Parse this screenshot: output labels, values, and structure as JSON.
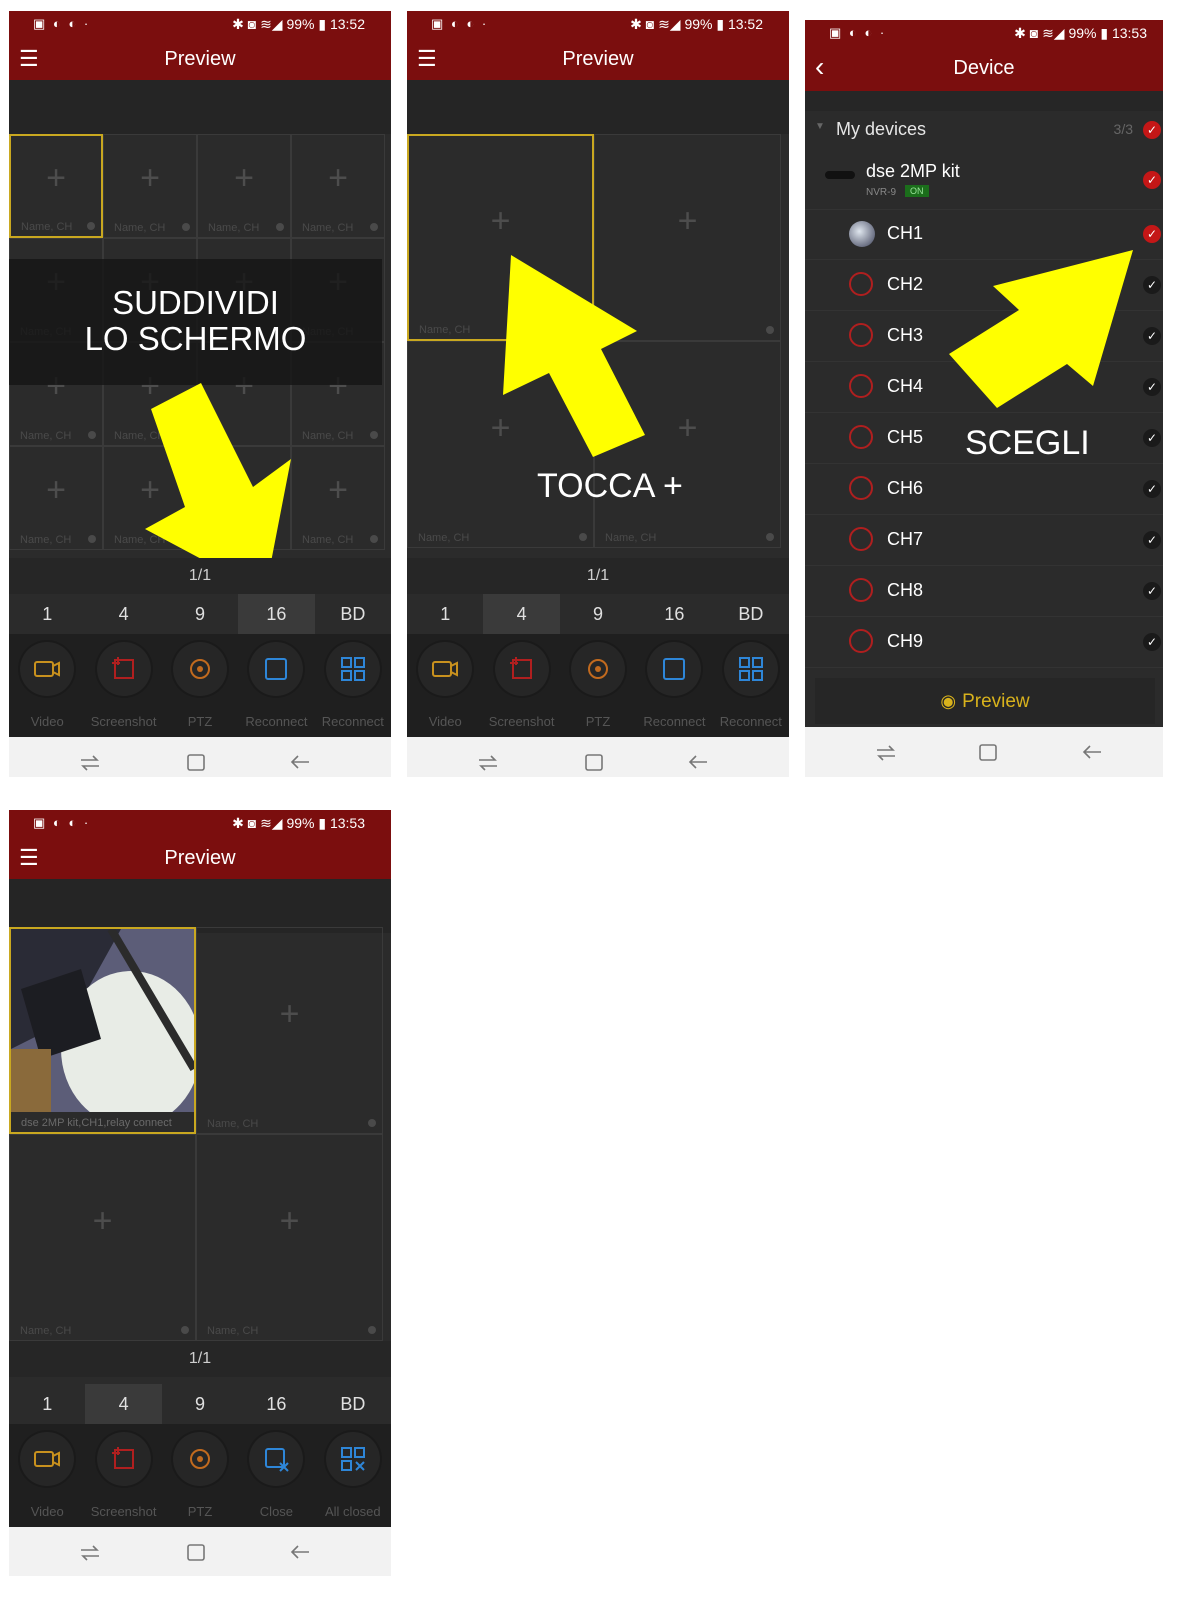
{
  "status": {
    "left_icons": "▣ ◐ ◐ ·",
    "right_1": "✱ ◙ ≋◢ 99% ▮ 13:52",
    "right_3": "✱ ◙ ≋◢ 99% ▮ 13:53"
  },
  "screen_titles": {
    "preview": "Preview",
    "device": "Device"
  },
  "cell_label": "Name, CH",
  "live_cell_label": "dse 2MP kit,CH1,relay connect",
  "page_indicator": "1/1",
  "split_tabs": [
    "1",
    "4",
    "9",
    "16",
    "BD"
  ],
  "actions_a": [
    "Video",
    "Screenshot",
    "PTZ",
    "Reconnect",
    "Reconnect"
  ],
  "actions_b": [
    "Video",
    "Screenshot",
    "PTZ",
    "Close",
    "All closed"
  ],
  "annotations": {
    "split_line1": "SUDDIVIDI",
    "split_line2": "LO SCHERMO",
    "tap": "TOCCA +",
    "choose": "SCEGLI"
  },
  "device_list": {
    "group": "My devices",
    "count": "3/3",
    "device_name": "dse 2MP kit",
    "device_model": "NVR-9",
    "device_status": "ON",
    "channels": [
      "CH1",
      "CH2",
      "CH3",
      "CH4",
      "CH5",
      "CH6",
      "CH7",
      "CH8",
      "CH9"
    ],
    "preview_label": "Preview"
  },
  "colors": {
    "header": "#7b0e0e",
    "accent": "#d8b21c",
    "arrow": "#ffff00"
  }
}
